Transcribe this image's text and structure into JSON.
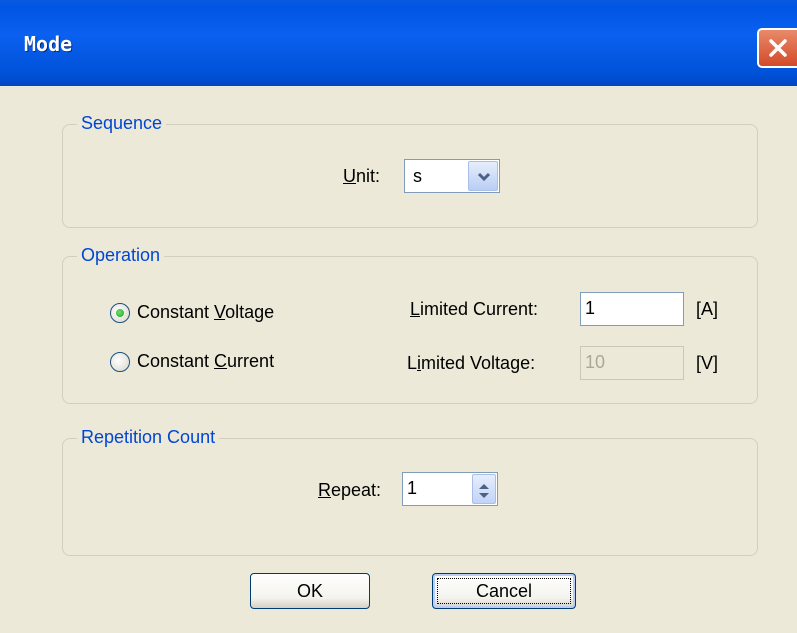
{
  "window": {
    "title": "Mode"
  },
  "sequence": {
    "legend": "Sequence",
    "unit_label": "Unit:",
    "unit_mnemonic": "U",
    "unit_label_rest": "nit:",
    "unit_value": "s"
  },
  "operation": {
    "legend": "Operation",
    "cv": {
      "pre": "Constant ",
      "mnemonic": "V",
      "post": "oltage",
      "selected": true
    },
    "cc": {
      "pre": "Constant ",
      "mnemonic": "C",
      "post": "urrent",
      "selected": false
    },
    "limited_current": {
      "mnemonic": "L",
      "rest": "imited Current:",
      "value": "1",
      "unit": "[A]"
    },
    "limited_voltage": {
      "pre": "L",
      "mnemonic": "i",
      "rest": "mited Voltage:",
      "value": "10",
      "unit": "[V]",
      "disabled": true
    }
  },
  "repetition": {
    "legend": "Repetition Count",
    "repeat_mnemonic": "R",
    "repeat_rest": "epeat:",
    "value": "1"
  },
  "buttons": {
    "ok": "OK",
    "cancel": "Cancel"
  },
  "colors": {
    "titlebar": "#0055e5",
    "legend": "#0046d5",
    "close": "#d44a28",
    "background": "#ece9d8"
  }
}
